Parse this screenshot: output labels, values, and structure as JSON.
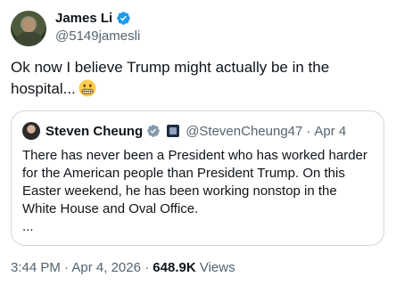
{
  "author": {
    "name": "James Li",
    "handle": "@5149jamesli",
    "verified_color": "#1d9bf0"
  },
  "tweet": {
    "text": "Ok now I believe Trump might actually be in the hospital...",
    "emoji": "grimacing-face-icon"
  },
  "quoted": {
    "name": "Steven Cheung",
    "handle": "@StevenCheung47",
    "separator": "·",
    "date": "Apr 4",
    "verified_color": "#829aab",
    "lines": [
      "There has never been a President who has worked harder",
      "for the American people than President Trump. On this",
      "Easter weekend, he has been working nonstop in the",
      "White House and Oval Office.",
      "..."
    ]
  },
  "meta": {
    "time": "3:44 PM",
    "dot1": "·",
    "date": "Apr 4, 2026",
    "dot2": "·",
    "views_count": "648.9K",
    "views_label": "Views"
  }
}
